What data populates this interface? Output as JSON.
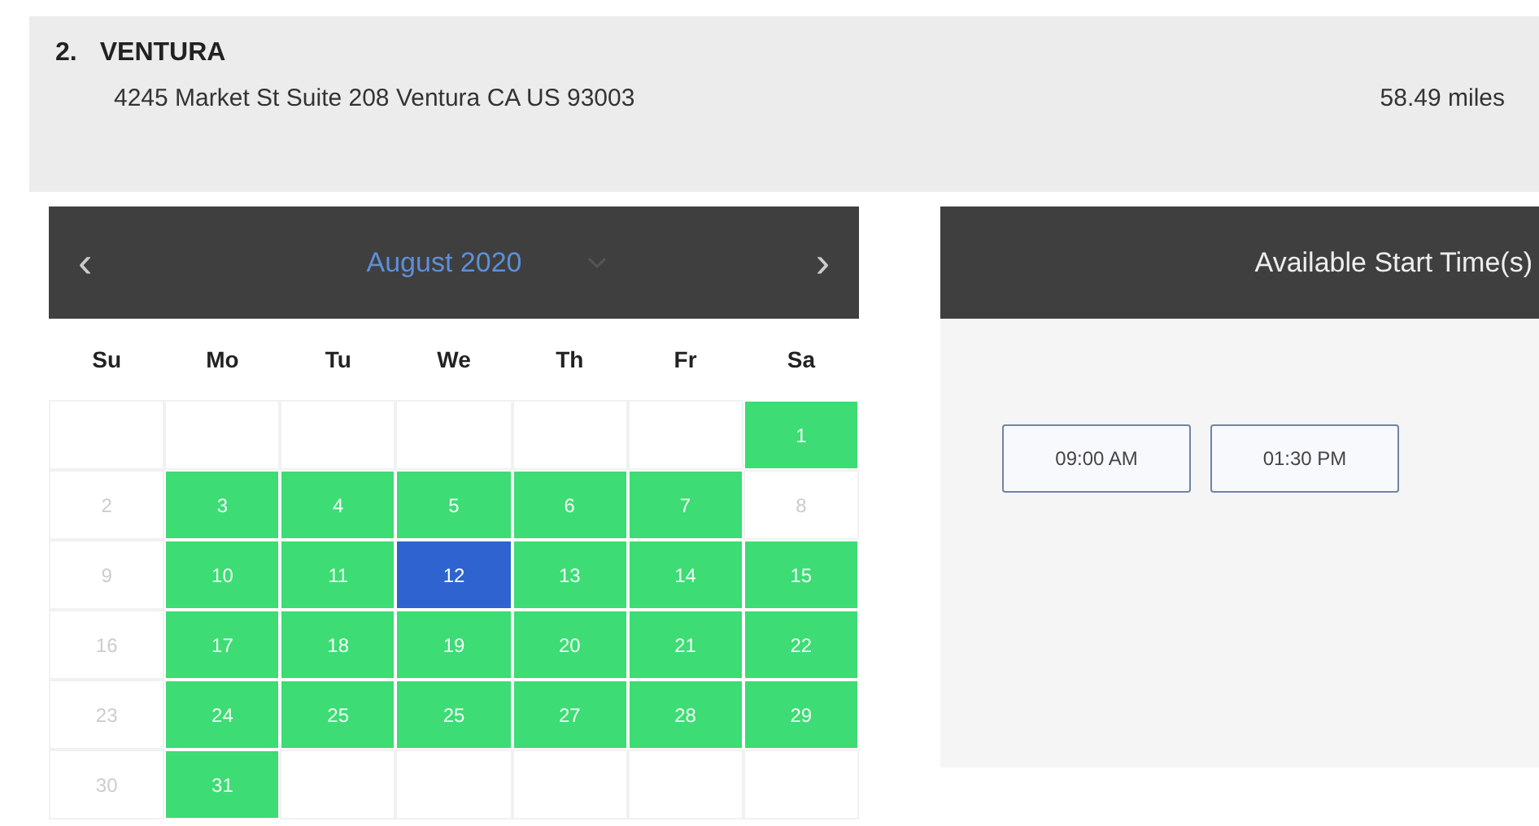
{
  "location": {
    "number": "2.",
    "name": "VENTURA",
    "address": "4245 Market St Suite 208 Ventura CA US 93003",
    "distance": "58.49 miles"
  },
  "calendar": {
    "prev": "‹",
    "month": "August 2020",
    "next": "›",
    "weekdays": [
      "Su",
      "Mo",
      "Tu",
      "We",
      "Th",
      "Fr",
      "Sa"
    ],
    "weeks": [
      [
        {
          "kind": "blank"
        },
        {
          "kind": "blank"
        },
        {
          "kind": "blank"
        },
        {
          "kind": "blank"
        },
        {
          "kind": "blank"
        },
        {
          "kind": "blank"
        },
        {
          "kind": "day",
          "label": "1",
          "available": true,
          "selected": false
        }
      ],
      [
        {
          "kind": "day",
          "label": "2",
          "available": false,
          "selected": false
        },
        {
          "kind": "day",
          "label": "3",
          "available": true,
          "selected": false
        },
        {
          "kind": "day",
          "label": "4",
          "available": true,
          "selected": false
        },
        {
          "kind": "day",
          "label": "5",
          "available": true,
          "selected": false
        },
        {
          "kind": "day",
          "label": "6",
          "available": true,
          "selected": false
        },
        {
          "kind": "day",
          "label": "7",
          "available": true,
          "selected": false
        },
        {
          "kind": "day",
          "label": "8",
          "available": false,
          "selected": false
        }
      ],
      [
        {
          "kind": "day",
          "label": "9",
          "available": false,
          "selected": false
        },
        {
          "kind": "day",
          "label": "10",
          "available": true,
          "selected": false
        },
        {
          "kind": "day",
          "label": "11",
          "available": true,
          "selected": false
        },
        {
          "kind": "day",
          "label": "12",
          "available": true,
          "selected": true
        },
        {
          "kind": "day",
          "label": "13",
          "available": true,
          "selected": false
        },
        {
          "kind": "day",
          "label": "14",
          "available": true,
          "selected": false
        },
        {
          "kind": "day",
          "label": "15",
          "available": true,
          "selected": false
        }
      ],
      [
        {
          "kind": "day",
          "label": "16",
          "available": false,
          "selected": false
        },
        {
          "kind": "day",
          "label": "17",
          "available": true,
          "selected": false
        },
        {
          "kind": "day",
          "label": "18",
          "available": true,
          "selected": false
        },
        {
          "kind": "day",
          "label": "19",
          "available": true,
          "selected": false
        },
        {
          "kind": "day",
          "label": "20",
          "available": true,
          "selected": false
        },
        {
          "kind": "day",
          "label": "21",
          "available": true,
          "selected": false
        },
        {
          "kind": "day",
          "label": "22",
          "available": true,
          "selected": false
        }
      ],
      [
        {
          "kind": "day",
          "label": "23",
          "available": false,
          "selected": false
        },
        {
          "kind": "day",
          "label": "24",
          "available": true,
          "selected": false
        },
        {
          "kind": "day",
          "label": "25",
          "available": true,
          "selected": false
        },
        {
          "kind": "day",
          "label": "25",
          "available": true,
          "selected": false
        },
        {
          "kind": "day",
          "label": "27",
          "available": true,
          "selected": false
        },
        {
          "kind": "day",
          "label": "28",
          "available": true,
          "selected": false
        },
        {
          "kind": "day",
          "label": "29",
          "available": true,
          "selected": false
        }
      ],
      [
        {
          "kind": "day",
          "label": "30",
          "available": false,
          "selected": false
        },
        {
          "kind": "day",
          "label": "31",
          "available": true,
          "selected": false
        },
        {
          "kind": "blank"
        },
        {
          "kind": "blank"
        },
        {
          "kind": "blank"
        },
        {
          "kind": "blank"
        },
        {
          "kind": "blank"
        }
      ]
    ]
  },
  "times": {
    "title": "Available Start Time(s)",
    "slots": [
      "09:00 AM",
      "01:30 PM"
    ]
  }
}
